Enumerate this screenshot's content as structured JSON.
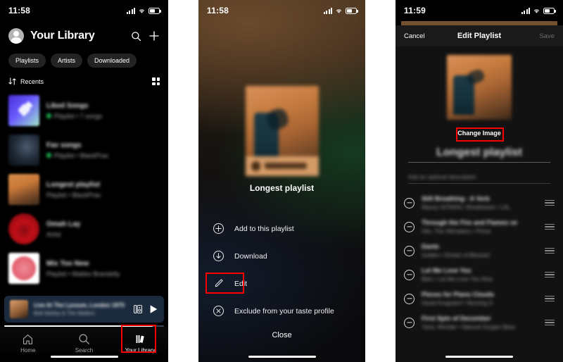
{
  "panel1": {
    "status": {
      "time": "11:58",
      "signal_icon": "cellular-signal-icon",
      "wifi_icon": "wifi-icon",
      "battery_icon": "battery-icon"
    },
    "header": {
      "title": "Your Library",
      "avatar_icon": "avatar-icon",
      "search_icon": "search-icon",
      "add_icon": "plus-icon"
    },
    "chips": [
      "Playlists",
      "Artists",
      "Downloaded"
    ],
    "sort": {
      "label": "Recents",
      "sort_icon": "sort-arrows-icon",
      "view_icon": "grid-view-icon"
    },
    "items": [
      {
        "title": "Liked Songs",
        "subtitle": "Playlist • 7 songs",
        "downloaded": true,
        "art": "liked"
      },
      {
        "title": "Fav songs",
        "subtitle": "Playlist • BlackPrax",
        "downloaded": true,
        "art": "night"
      },
      {
        "title": "Longest playlist",
        "subtitle": "Playlist • BlackPrax",
        "downloaded": false,
        "art": "wood"
      },
      {
        "title": "Omah Lay",
        "subtitle": "Artist",
        "downloaded": false,
        "art": "red"
      },
      {
        "title": "Mix Too New",
        "subtitle": "Playlist • Matteo Brandelly",
        "downloaded": false,
        "art": "white"
      }
    ],
    "miniplayer": {
      "track": "Live At The Lyceum, London 1975",
      "artist": "Bob Marley & The Wailers",
      "devices_icon": "connect-devices-icon",
      "play_icon": "play-icon",
      "progress_percent": 93
    },
    "tabs": [
      {
        "label": "Home",
        "icon": "home-icon",
        "active": false
      },
      {
        "label": "Search",
        "icon": "search-icon",
        "active": false
      },
      {
        "label": "Your Library",
        "icon": "library-icon",
        "active": true
      }
    ]
  },
  "panel2": {
    "status": {
      "time": "11:58"
    },
    "playlist_title": "Longest playlist",
    "cover_icon": "playlist-cover-art",
    "menu": [
      {
        "label": "Add to this playlist",
        "icon": "plus-circle-icon"
      },
      {
        "label": "Download",
        "icon": "download-circle-icon"
      },
      {
        "label": "Edit",
        "icon": "pencil-icon"
      },
      {
        "label": "Exclude from your taste profile",
        "icon": "x-circle-icon"
      }
    ],
    "close_label": "Close"
  },
  "panel3": {
    "status": {
      "time": "11:59"
    },
    "nav": {
      "cancel": "Cancel",
      "title": "Edit Playlist",
      "save": "Save"
    },
    "cover_icon": "playlist-cover-art",
    "change_image_label": "Change Image",
    "name_value": "Longest playlist",
    "description_placeholder": "Add an optional description",
    "tracks": [
      {
        "name": "Still Breathing - A Verb",
        "artist": "Manny HITMAN • Breathtown • LAL",
        "remove_icon": "minus-circle-icon",
        "drag_icon": "drag-handle-icon"
      },
      {
        "name": "Through the Fire and Flames ve",
        "artist": "Hits, The Hitmakers • Prime",
        "remove_icon": "minus-circle-icon",
        "drag_icon": "drag-handle-icon"
      },
      {
        "name": "Dante",
        "artist": "Golden • Dream of Blessed",
        "remove_icon": "minus-circle-icon",
        "drag_icon": "drag-handle-icon"
      },
      {
        "name": "Let Me Love You",
        "artist": "Blen • Let Me Love You Now",
        "remove_icon": "minus-circle-icon",
        "drag_icon": "drag-handle-icon"
      },
      {
        "name": "Pieces for Piano Clouds",
        "artist": "David Krugsdorf • Morning S",
        "remove_icon": "minus-circle-icon",
        "drag_icon": "drag-handle-icon"
      },
      {
        "name": "First Spin of December",
        "artist": "Yana, Wonder • Natural Oxygen Bass",
        "remove_icon": "minus-circle-icon",
        "drag_icon": "drag-handle-icon"
      }
    ]
  },
  "annotations": {
    "accent_color": "#ff0000",
    "boxes": [
      "your-library-tab-highlight",
      "edit-menu-item-highlight",
      "change-image-highlight"
    ]
  }
}
